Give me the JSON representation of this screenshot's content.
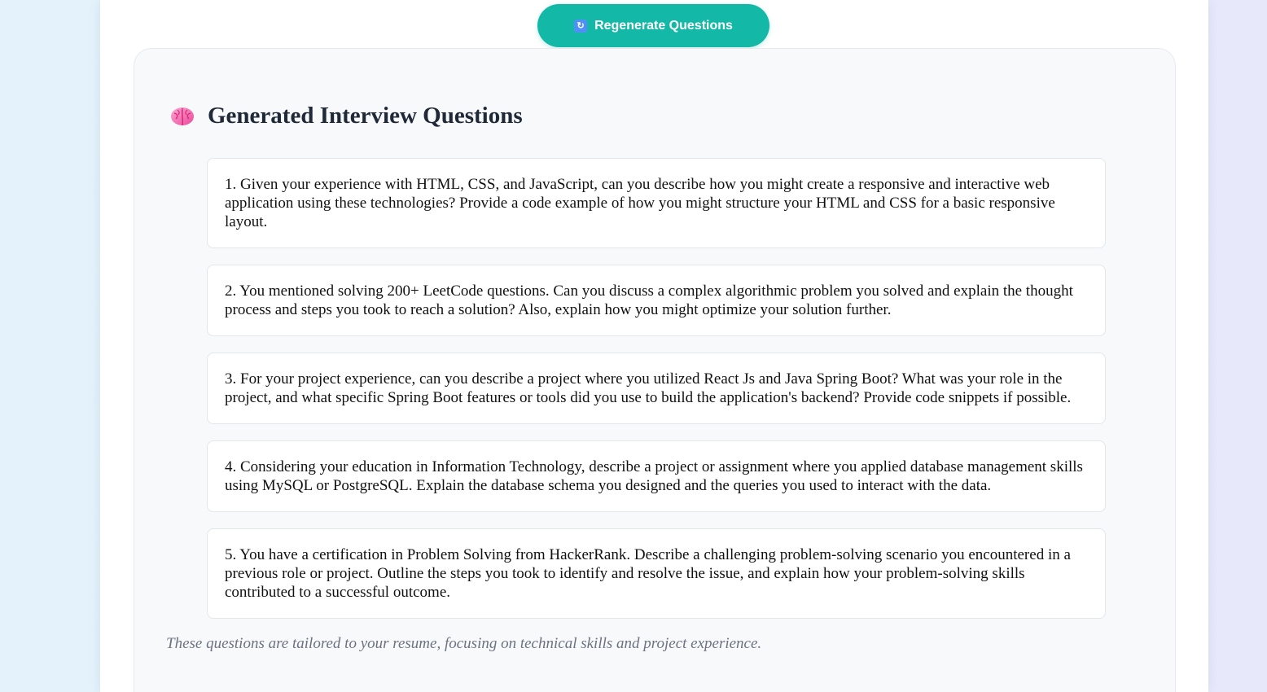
{
  "toolbar": {
    "regenerate_label": "Regenerate Questions",
    "regenerate_icon": "refresh-icon"
  },
  "section": {
    "icon": "brain-icon",
    "title": "Generated Interview Questions"
  },
  "questions": [
    "1. Given your experience with HTML, CSS, and JavaScript, can you describe how you might create a responsive and interactive web application using these technologies? Provide a code example of how you might structure your HTML and CSS for a basic responsive layout.",
    "2. You mentioned solving 200+ LeetCode questions. Can you discuss a complex algorithmic problem you solved and explain the thought process and steps you took to reach a solution? Also, explain how you might optimize your solution further.",
    "3. For your project experience, can you describe a project where you utilized React Js and Java Spring Boot? What was your role in the project, and what specific Spring Boot features or tools did you use to build the application's backend? Provide code snippets if possible.",
    "4. Considering your education in Information Technology, describe a project or assignment where you applied database management skills using MySQL or PostgreSQL. Explain the database schema you designed and the queries you used to interact with the data.",
    "5. You have a certification in Problem Solving from HackerRank. Describe a challenging problem-solving scenario you encountered in a previous role or project. Outline the steps you took to identify and resolve the issue, and explain how your problem-solving skills contributed to a successful outcome."
  ],
  "footnote": "These questions are tailored to your resume, focusing on technical skills and project experience.",
  "colors": {
    "accent": "#14b8a6",
    "card_background": "#f7f9fb"
  }
}
